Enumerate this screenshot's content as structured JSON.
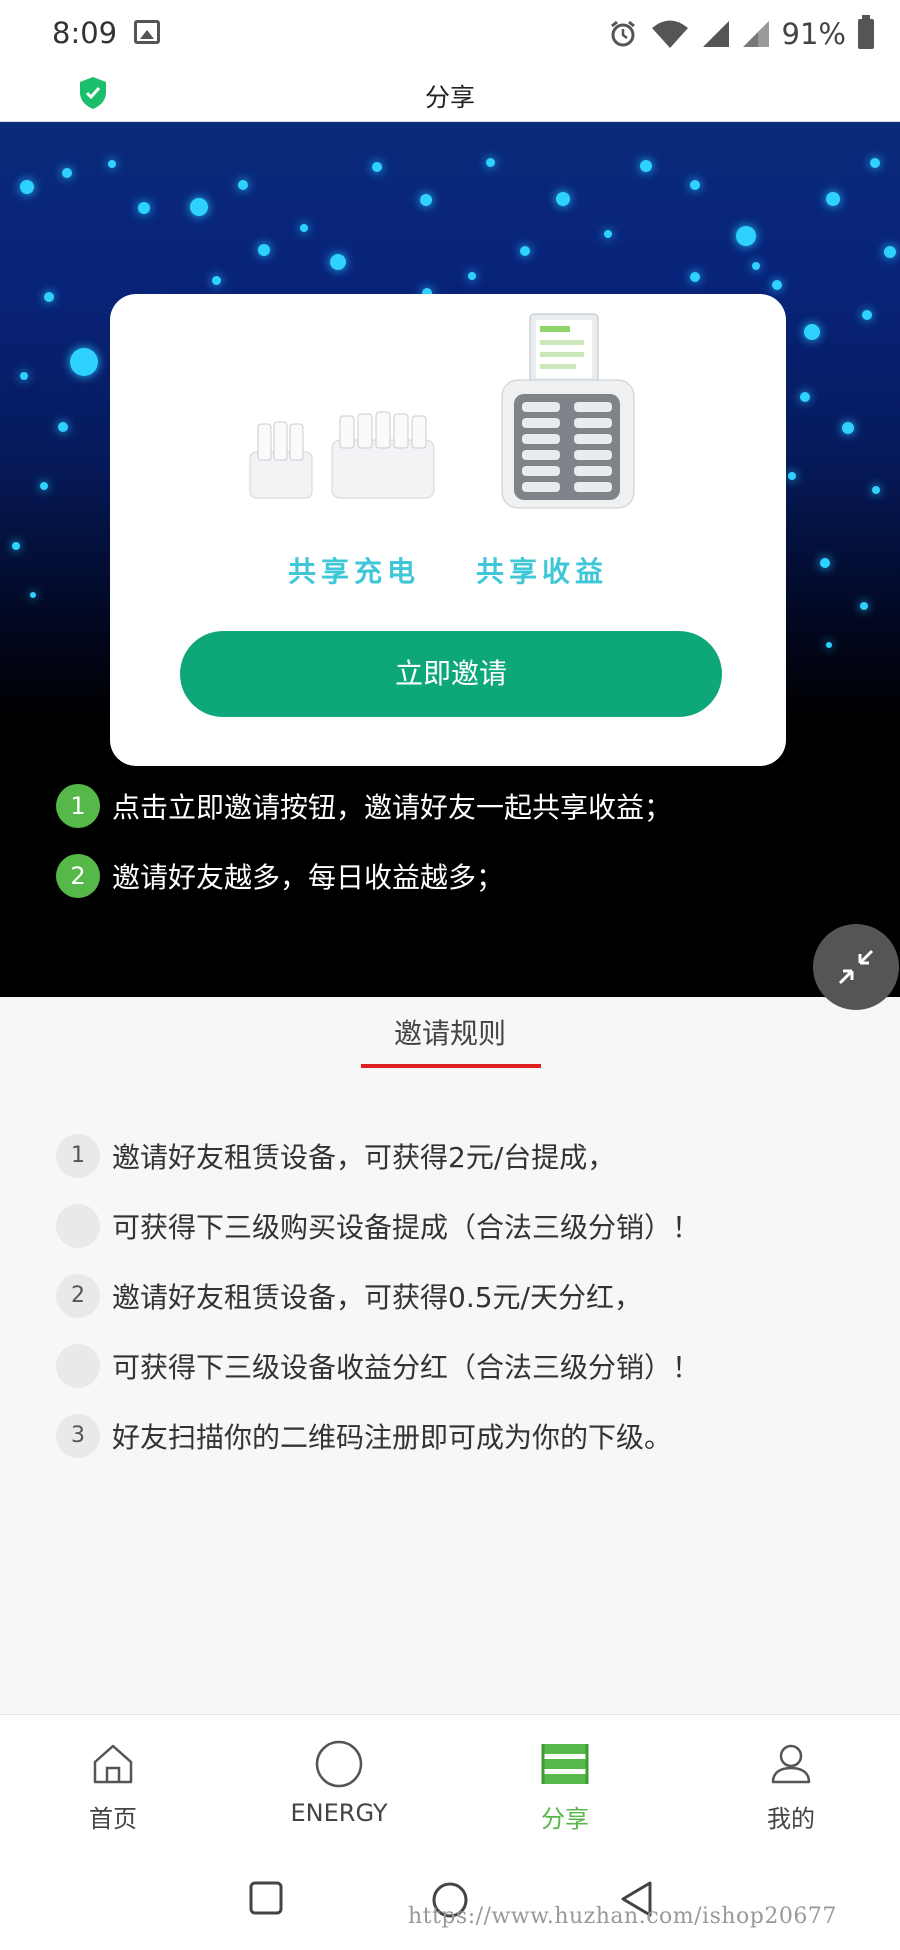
{
  "status_bar": {
    "time": "8:09",
    "battery_percent": "91%",
    "icons": [
      "image-icon",
      "alarm-icon",
      "wifi-icon",
      "signal-icon",
      "signal-icon",
      "battery-icon"
    ]
  },
  "title_bar": {
    "title": "分享",
    "left_icon": "shield-check-icon",
    "accent": "#1bbf6b"
  },
  "hero": {
    "slogans": [
      "共享充电",
      "共享收益"
    ],
    "invite_button_label": "立即邀请",
    "steps": [
      {
        "num": "1",
        "text": "点击立即邀请按钮，邀请好友一起共享收益；"
      },
      {
        "num": "2",
        "text": "邀请好友越多，每日收益越多；"
      }
    ],
    "fab_icon": "collapse-arrows-icon"
  },
  "rules": {
    "tab_label": "邀请规则",
    "items": [
      {
        "badge": "1",
        "text": "邀请好友租赁设备，可获得2元/台提成，"
      },
      {
        "badge": "",
        "text": "可获得下三级购买设备提成（合法三级分销）！"
      },
      {
        "badge": "2",
        "text": "邀请好友租赁设备，可获得0.5元/天分红，"
      },
      {
        "badge": "",
        "text": "可获得下三级设备收益分红（合法三级分销）！"
      },
      {
        "badge": "3",
        "text": "好友扫描你的二维码注册即可成为你的下级。"
      }
    ]
  },
  "bottom_nav": {
    "items": [
      {
        "label": "首页",
        "icon": "home-icon",
        "active": false
      },
      {
        "label": "ENERGY",
        "icon": "circle-icon",
        "active": false
      },
      {
        "label": "分享",
        "icon": "share-stack-icon",
        "active": true
      },
      {
        "label": "我的",
        "icon": "person-icon",
        "active": false
      }
    ],
    "active_color": "#55b848"
  },
  "system_nav": {
    "icons": [
      "recents-square-icon",
      "home-circle-icon",
      "back-triangle-icon"
    ],
    "watermark": "https://www.huzhan.com/ishop20677"
  }
}
